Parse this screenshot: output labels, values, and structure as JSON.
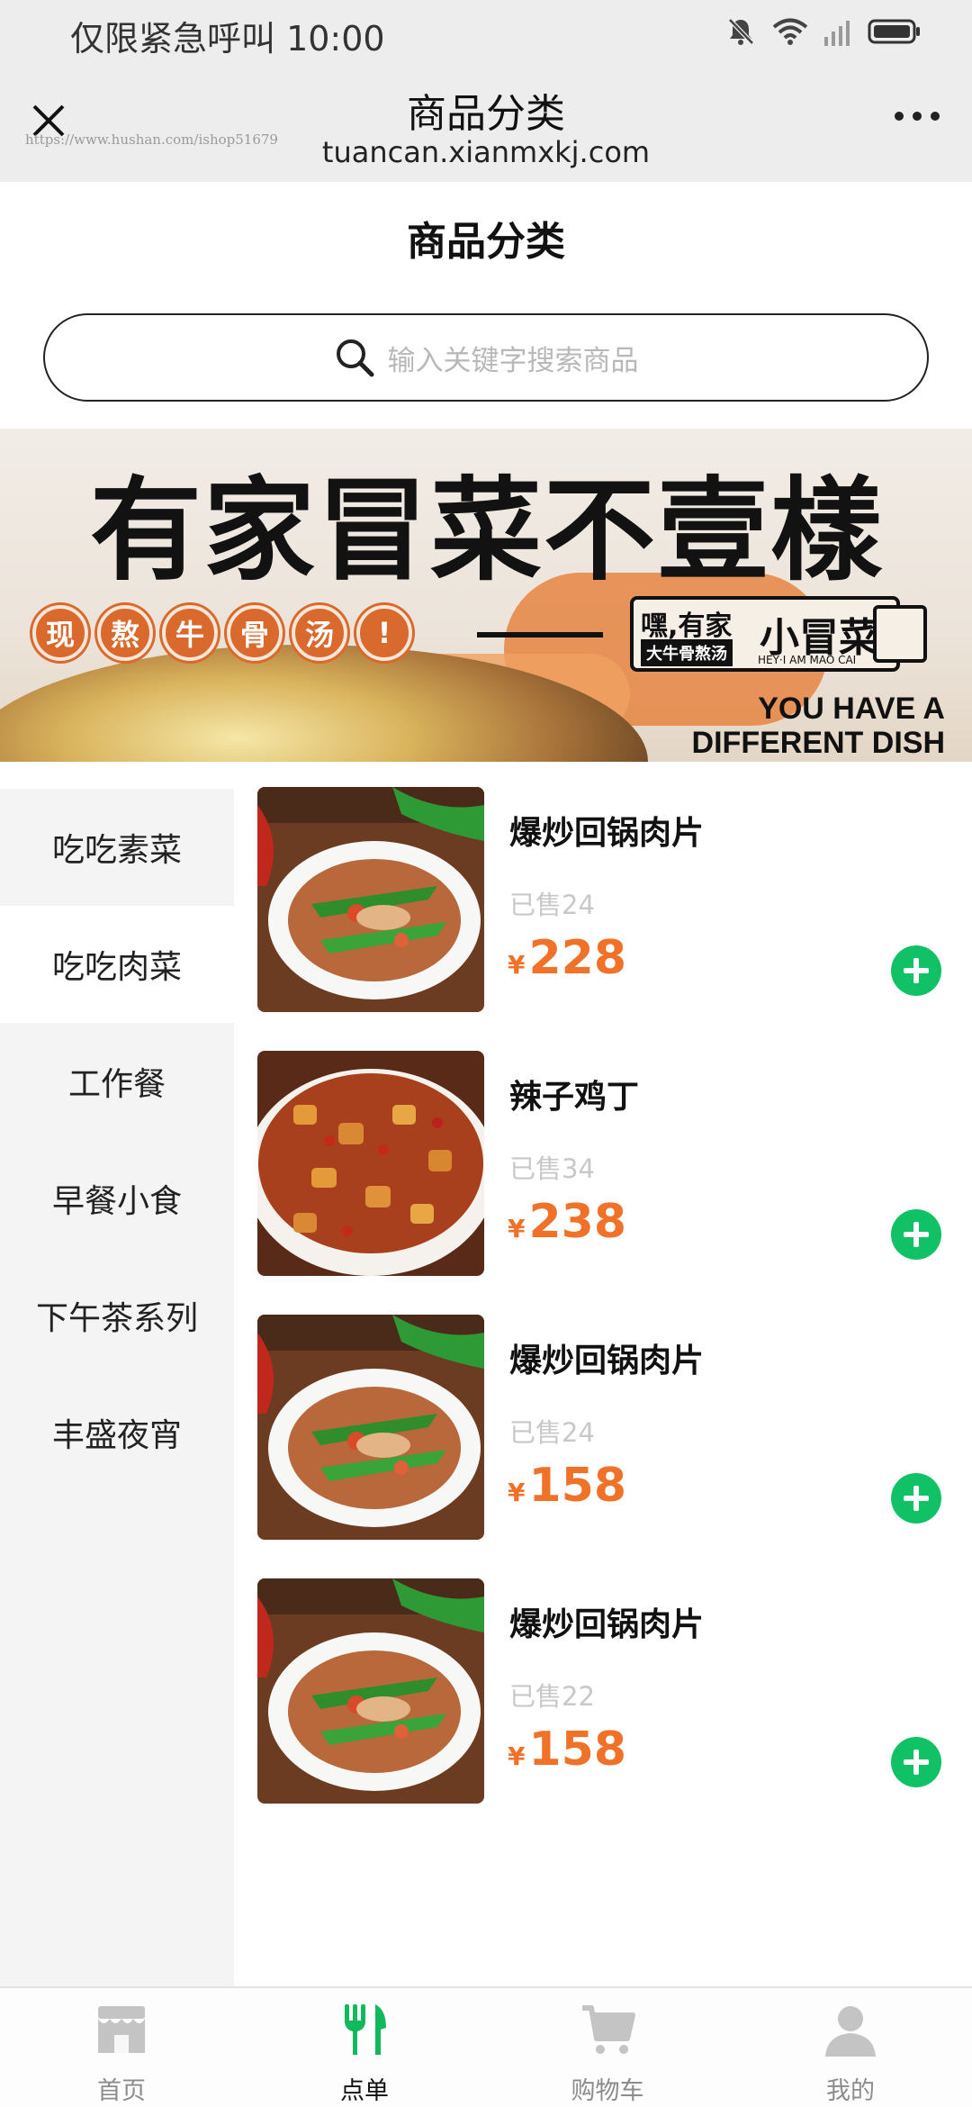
{
  "status_bar": {
    "text": "仅限紧急呼叫 10:00",
    "icons": [
      "bell-muted-icon",
      "wifi-icon",
      "signal-icon",
      "battery-icon"
    ]
  },
  "nav": {
    "title": "商品分类",
    "url": "tuancan.xianmxkj.com",
    "watermark": "https://www.hushan.com/ishop51679"
  },
  "page": {
    "title": "商品分类"
  },
  "search": {
    "placeholder": "输入关键字搜索商品"
  },
  "banner": {
    "headline": "有家冒菜不壹樣",
    "badges": [
      "现",
      "熬",
      "牛",
      "骨",
      "汤",
      "!"
    ],
    "brand_main": "嘿,有家",
    "brand_sub": "大牛骨熬汤",
    "brand_mini": "小冒菜",
    "brand_tiny": "HEY·I AM MAO CAI",
    "slogan_line1": "YOU HAVE A",
    "slogan_line2": "DIFFERENT DISH"
  },
  "categories": [
    {
      "label": "吃吃素菜",
      "active": false
    },
    {
      "label": "吃吃肉菜",
      "active": true
    },
    {
      "label": "工作餐",
      "active": false
    },
    {
      "label": "早餐小食",
      "active": false
    },
    {
      "label": "下午茶系列",
      "active": false
    },
    {
      "label": "丰盛夜宵",
      "active": false
    }
  ],
  "products": [
    {
      "name": "爆炒回锅肉片",
      "sold": "已售24",
      "currency": "¥",
      "price": "228",
      "image": "stir-fried-pork-photo"
    },
    {
      "name": "辣子鸡丁",
      "sold": "已售34",
      "currency": "¥",
      "price": "238",
      "image": "spicy-chicken-photo"
    },
    {
      "name": "爆炒回锅肉片",
      "sold": "已售24",
      "currency": "¥",
      "price": "158",
      "image": "stir-fried-pork-photo"
    },
    {
      "name": "爆炒回锅肉片",
      "sold": "已售22",
      "currency": "¥",
      "price": "158",
      "image": "stir-fried-pork-photo"
    }
  ],
  "tabbar": [
    {
      "label": "首页",
      "icon": "shop-icon",
      "active": false
    },
    {
      "label": "点单",
      "icon": "fork-knife-icon",
      "active": true
    },
    {
      "label": "购物车",
      "icon": "cart-icon",
      "active": false
    },
    {
      "label": "我的",
      "icon": "user-icon",
      "active": false
    }
  ],
  "colors": {
    "accent_green": "#10c265",
    "price_orange": "#f07228",
    "tab_active_green": "#12b85c",
    "tab_inactive_gray": "#bdbdbd"
  }
}
